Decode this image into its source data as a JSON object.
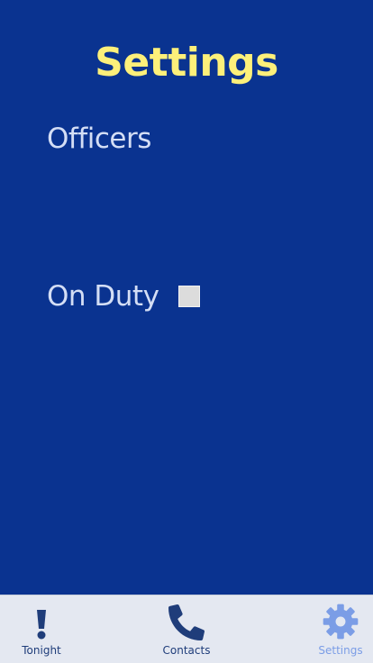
{
  "header": {
    "title": "Settings"
  },
  "sections": {
    "officers_label": "Officers",
    "on_duty_label": "On Duty",
    "on_duty_checked": false
  },
  "tabbar": {
    "tabs": [
      {
        "label": "Tonight",
        "icon": "exclamation-icon",
        "active": false
      },
      {
        "label": "Contacts",
        "icon": "phone-icon",
        "active": false
      },
      {
        "label": "Settings",
        "icon": "gear-icon",
        "active": true
      }
    ]
  },
  "colors": {
    "background": "#0a3390",
    "title": "#fdf07a",
    "label": "#d4def5",
    "tab_inactive": "#1f3d7a",
    "tab_active": "#7b9de6"
  }
}
